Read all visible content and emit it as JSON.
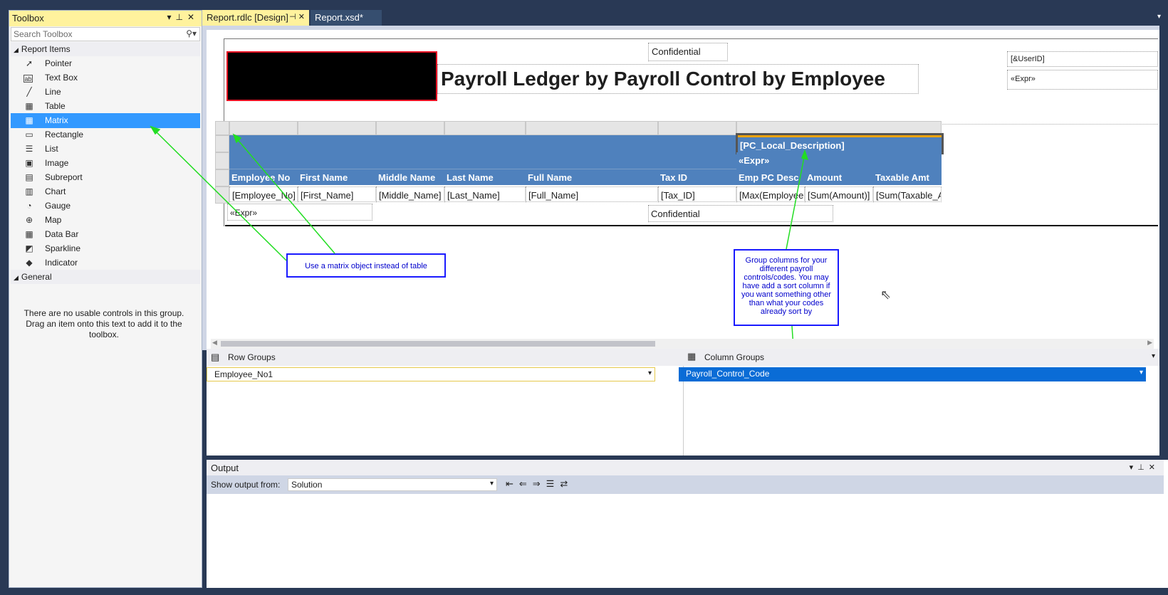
{
  "toolbox": {
    "title": "Toolbox",
    "search_placeholder": "Search Toolbox",
    "group_report_items": "Report Items",
    "items": [
      {
        "label": "Pointer",
        "icon": "pointer-icon"
      },
      {
        "label": "Text Box",
        "icon": "textbox-icon"
      },
      {
        "label": "Line",
        "icon": "line-icon"
      },
      {
        "label": "Table",
        "icon": "table-icon"
      },
      {
        "label": "Matrix",
        "icon": "matrix-icon"
      },
      {
        "label": "Rectangle",
        "icon": "rectangle-icon"
      },
      {
        "label": "List",
        "icon": "list-icon"
      },
      {
        "label": "Image",
        "icon": "image-icon"
      },
      {
        "label": "Subreport",
        "icon": "subreport-icon"
      },
      {
        "label": "Chart",
        "icon": "chart-icon"
      },
      {
        "label": "Gauge",
        "icon": "gauge-icon"
      },
      {
        "label": "Map",
        "icon": "map-icon"
      },
      {
        "label": "Data Bar",
        "icon": "databar-icon"
      },
      {
        "label": "Sparkline",
        "icon": "sparkline-icon"
      },
      {
        "label": "Indicator",
        "icon": "indicator-icon"
      }
    ],
    "group_general": "General",
    "general_empty": "There are no usable controls in this group. Drag an item onto this text to add it to the toolbox."
  },
  "tabs": [
    {
      "label": "Report.rdlc [Design]"
    },
    {
      "label": "Report.xsd*"
    }
  ],
  "report": {
    "confidential_top": "Confidential",
    "title": "Payroll Ledger by Payroll Control by Employee",
    "user_id": "[&UserID]",
    "expr_top": "«Expr»",
    "pc_local_desc": "[PC_Local_Description]",
    "pc_expr": "«Expr»",
    "headers": [
      "Employee No",
      "First Name",
      "Middle Name",
      "Last Name",
      "Full Name",
      "Tax ID",
      "Emp PC Desc",
      "Amount",
      "Taxable Amt"
    ],
    "data": [
      "[Employee_No]",
      "[First_Name]",
      "[Middle_Name]",
      "[Last_Name]",
      "[Full_Name]",
      "[Tax_ID]",
      "[Max(Employee",
      "[Sum(Amount)]",
      "[Sum(Taxable_A"
    ],
    "expr_bottom": "«Expr»",
    "confidential_bottom": "Confidential"
  },
  "callouts": {
    "matrix": "Use a matrix object instead of table",
    "groups": "Group columns for your different payroll controls/codes. You may have add a sort column if you want something other than what your codes already sort by"
  },
  "groups": {
    "row_title": "Row Groups",
    "row_value": "Employee_No1",
    "col_title": "Column Groups",
    "col_value": "Payroll_Control_Code"
  },
  "output": {
    "title": "Output",
    "show_from_label": "Show output from:",
    "source": "Solution"
  },
  "colors": {
    "accent": "#3399ff",
    "header_fill": "#4f81bd",
    "callout": "#1a1aff",
    "arrow": "#22dd22"
  }
}
